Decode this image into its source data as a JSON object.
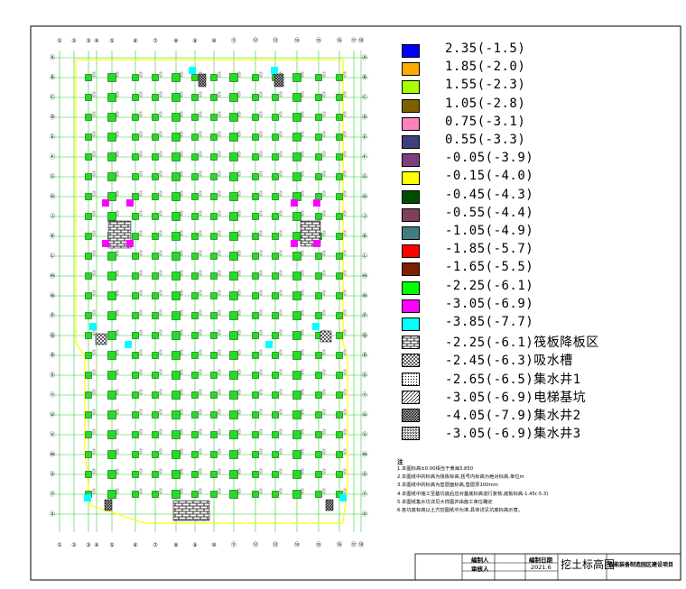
{
  "legend": [
    {
      "label": "2.35(-1.5)",
      "color": "#0000ff",
      "pattern": "solid"
    },
    {
      "label": "1.85(-2.0)",
      "color": "#ffaa00",
      "pattern": "solid"
    },
    {
      "label": "1.55(-2.3)",
      "color": "#aaff00",
      "pattern": "solid"
    },
    {
      "label": "1.05(-2.8)",
      "color": "#7f6000",
      "pattern": "solid"
    },
    {
      "label": "0.75(-3.1)",
      "color": "#ff7fbf",
      "pattern": "solid"
    },
    {
      "label": "0.55(-3.3)",
      "color": "#3f3f7f",
      "pattern": "solid"
    },
    {
      "label": "-0.05(-3.9)",
      "color": "#7f3f7f",
      "pattern": "solid"
    },
    {
      "label": "-0.15(-4.0)",
      "color": "#ffff00",
      "pattern": "solid"
    },
    {
      "label": "-0.45(-4.3)",
      "color": "#004c00",
      "pattern": "solid"
    },
    {
      "label": "-0.55(-4.4)",
      "color": "#7f3f5f",
      "pattern": "solid"
    },
    {
      "label": "-1.05(-4.9)",
      "color": "#3f7f7f",
      "pattern": "solid"
    },
    {
      "label": "-1.85(-5.7)",
      "color": "#ff0000",
      "pattern": "solid"
    },
    {
      "label": "-1.65(-5.5)",
      "color": "#7f1f00",
      "pattern": "solid"
    },
    {
      "label": "-2.25(-6.1)",
      "color": "#00ff00",
      "pattern": "solid"
    },
    {
      "label": "-3.05(-6.9)",
      "color": "#ff00ff",
      "pattern": "solid"
    },
    {
      "label": "-3.85(-7.7)",
      "color": "#00ffff",
      "pattern": "solid"
    },
    {
      "label": "-2.25(-6.1)筏板降板区",
      "color": "#000000",
      "pattern": "brick"
    },
    {
      "label": "-2.45(-6.3)吸水槽",
      "color": "#000000",
      "pattern": "cross"
    },
    {
      "label": "-2.65(-6.5)集水井1",
      "color": "#000000",
      "pattern": "dots"
    },
    {
      "label": "-3.05(-6.9)电梯基坑",
      "color": "#000000",
      "pattern": "diag"
    },
    {
      "label": "-4.05(-7.9)集水井2",
      "color": "#000000",
      "pattern": "dense"
    },
    {
      "label": "-3.05(-6.9)集水井3",
      "color": "#000000",
      "pattern": "grid"
    }
  ],
  "notes": {
    "title": "注",
    "lines": [
      "1.本图标高±0.00相当于黄海3.850",
      "2.本图纸中的标高为筏板标高,括号内标高为绝对标高,单位m",
      "3.本图纸中的标高为垫层面标高,垫层厚100mm",
      "4.本图纸中施工至基坑底后应对基底标高进行复核,底板标高-1.45(-5.3)",
      "5.本图纸集水坑详见大样图并由施工单位确定",
      "6.各坑底标高以土方挖图纸中为准,具体详见坑底标高示意。"
    ]
  },
  "title_block": {
    "drawn_by_label": "编制人",
    "reviewer_label": "审核人",
    "date_label": "编制日期",
    "date_value": "2021.6",
    "drawing_title": "挖土标高图",
    "project_name": "智能装备制造园区建设项目"
  },
  "axis_labels": {
    "top": [
      "①",
      "②",
      "③",
      "④",
      "⑤",
      "⑥",
      "⑦",
      "⑧",
      "⑨",
      "⑩",
      "⑪",
      "⑫",
      "⑬",
      "⑭",
      "⑮",
      "⑯",
      "⑰",
      "⑱"
    ],
    "left": [
      "Ⓐ",
      "Ⓑ",
      "Ⓒ",
      "Ⓓ",
      "Ⓔ",
      "Ⓕ",
      "Ⓖ",
      "Ⓗ",
      "Ⓙ",
      "Ⓚ",
      "Ⓛ",
      "Ⓜ",
      "Ⓝ",
      "Ⓟ",
      "Ⓠ",
      "Ⓡ",
      "Ⓢ",
      "Ⓣ",
      "Ⓤ",
      "Ⓥ",
      "Ⓦ",
      "Ⓧ",
      "Ⓨ",
      "Ⓩ"
    ]
  },
  "colors": {
    "grid_line": "#33cc33",
    "boundary": "#ffff00",
    "column_pad": "#22dd22",
    "frame": "#000000"
  }
}
